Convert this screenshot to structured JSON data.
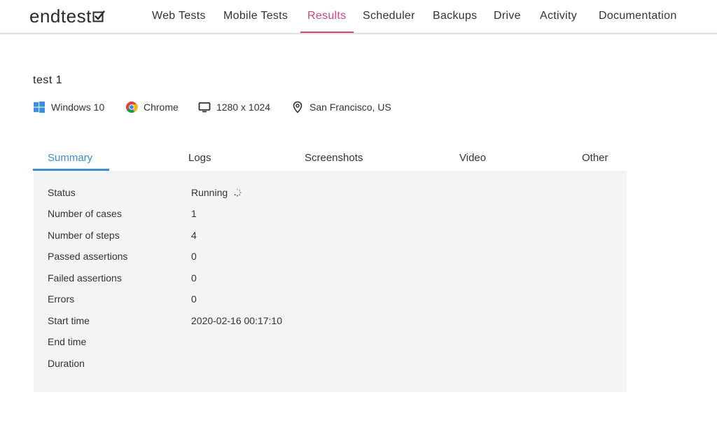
{
  "header": {
    "logo_text": "endtest",
    "nav": [
      {
        "label": "Web Tests"
      },
      {
        "label": "Mobile Tests"
      },
      {
        "label": "Results"
      },
      {
        "label": "Scheduler"
      },
      {
        "label": "Backups"
      },
      {
        "label": "Drive"
      },
      {
        "label": "Activity"
      },
      {
        "label": "Documentation"
      }
    ],
    "active_nav": "Results",
    "accent_color": "#d9437d"
  },
  "test": {
    "title": "test 1",
    "environment": {
      "os": "Windows 10",
      "os_icon": "windows-icon",
      "browser": "Chrome",
      "browser_icon": "chrome-icon",
      "resolution": "1280 x 1024",
      "resolution_icon": "monitor-icon",
      "location": "San Francisco, US",
      "location_icon": "location-pin-icon"
    }
  },
  "tabs": {
    "items": [
      {
        "label": "Summary"
      },
      {
        "label": "Logs"
      },
      {
        "label": "Screenshots"
      },
      {
        "label": "Video"
      },
      {
        "label": "Other"
      }
    ],
    "active": "Summary",
    "active_color": "#3a8ed8"
  },
  "summary": {
    "rows": [
      {
        "key": "Status",
        "value": "Running"
      },
      {
        "key": "Number of cases",
        "value": "1"
      },
      {
        "key": "Number of steps",
        "value": "4"
      },
      {
        "key": "Passed assertions",
        "value": "0"
      },
      {
        "key": "Failed assertions",
        "value": "0"
      },
      {
        "key": "Errors",
        "value": "0"
      },
      {
        "key": "Start time",
        "value": "2020-02-16 00:17:10"
      },
      {
        "key": "End time",
        "value": ""
      },
      {
        "key": "Duration",
        "value": ""
      }
    ],
    "status_icon": "loading-spinner-icon",
    "panel_color": "#f4f4f4"
  }
}
